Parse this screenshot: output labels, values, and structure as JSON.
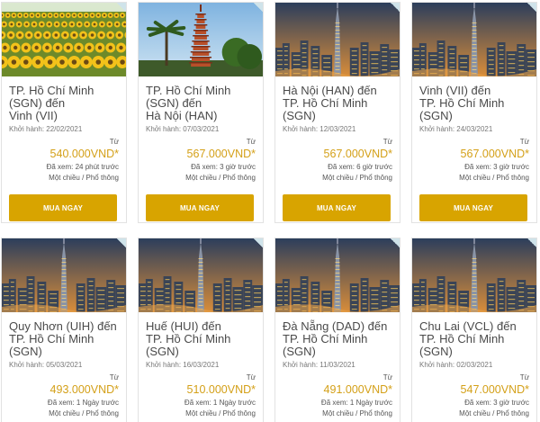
{
  "cards": [
    {
      "route": "TP. Hồ Chí Minh\n(SGN) đến\nVinh (VII)",
      "depart": "Khởi hành: 22/02/2021",
      "from": "Từ",
      "price": "540.000VND*",
      "viewed": "Đã xem: 24 phút trước",
      "fare": "Một chiều / Phổ thông",
      "button": "MUA NGAY",
      "image": "sunflowers"
    },
    {
      "route": "TP. Hồ Chí Minh\n(SGN) đến\nHà Nội (HAN)",
      "depart": "Khởi hành: 07/03/2021",
      "from": "Từ",
      "price": "567.000VND*",
      "viewed": "Đã xem: 3 giờ trước",
      "fare": "Một chiều / Phổ thông",
      "button": "MUA NGAY",
      "image": "pagoda"
    },
    {
      "route": "Hà Nội (HAN) đến\nTP. Hồ Chí Minh\n(SGN)",
      "depart": "Khởi hành: 12/03/2021",
      "from": "Từ",
      "price": "567.000VND*",
      "viewed": "Đã xem: 6 giờ trước",
      "fare": "Một chiều / Phổ thông",
      "button": "MUA NGAY",
      "image": "city"
    },
    {
      "route": "Vinh (VII) đến\nTP. Hồ Chí Minh\n(SGN)",
      "depart": "Khởi hành: 24/03/2021",
      "from": "Từ",
      "price": "567.000VND*",
      "viewed": "Đã xem: 3 giờ trước",
      "fare": "Một chiều / Phổ thông",
      "button": "MUA NGAY",
      "image": "city"
    },
    {
      "route": "Quy Nhơn (UIH) đến\nTP. Hồ Chí Minh\n(SGN)",
      "depart": "Khởi hành: 05/03/2021",
      "from": "Từ",
      "price": "493.000VND*",
      "viewed": "Đã xem: 1 Ngày trước",
      "fare": "Một chiều / Phổ thông",
      "button": "MUA NGAY",
      "image": "city"
    },
    {
      "route": "Huế (HUI) đến\nTP. Hồ Chí Minh\n(SGN)",
      "depart": "Khởi hành: 16/03/2021",
      "from": "Từ",
      "price": "510.000VND*",
      "viewed": "Đã xem: 1 Ngày trước",
      "fare": "Một chiều / Phổ thông",
      "button": "MUA NGAY",
      "image": "city"
    },
    {
      "route": "Đà Nẵng (DAD) đến\nTP. Hồ Chí Minh\n(SGN)",
      "depart": "Khởi hành: 11/03/2021",
      "from": "Từ",
      "price": "491.000VND*",
      "viewed": "Đã xem: 1 Ngày trước",
      "fare": "Một chiều / Phổ thông",
      "button": "MUA NGAY",
      "image": "city"
    },
    {
      "route": "Chu Lai (VCL) đến\nTP. Hồ Chí Minh\n(SGN)",
      "depart": "Khởi hành: 02/03/2021",
      "from": "Từ",
      "price": "547.000VND*",
      "viewed": "Đã xem: 3 giờ trước",
      "fare": "Một chiều / Phổ thông",
      "button": "MUA NGAY",
      "image": "city"
    }
  ],
  "colors": {
    "accent": "#d8a400",
    "price": "#d4a018",
    "text": "#4a4a4a"
  }
}
